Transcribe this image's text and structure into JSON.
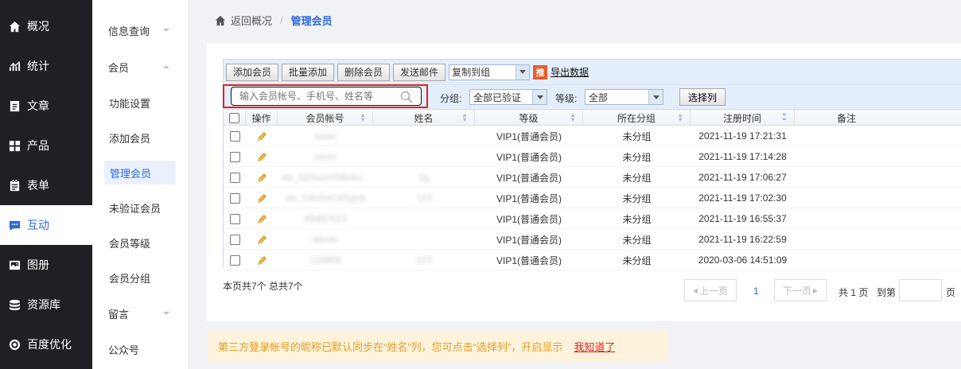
{
  "sidebar": {
    "items": [
      {
        "label": "概况",
        "icon": "home-icon"
      },
      {
        "label": "统计",
        "icon": "stats-icon"
      },
      {
        "label": "文章",
        "icon": "article-icon"
      },
      {
        "label": "产品",
        "icon": "product-icon"
      },
      {
        "label": "表单",
        "icon": "form-icon"
      },
      {
        "label": "互动",
        "icon": "chat-icon",
        "active": true
      },
      {
        "label": "图册",
        "icon": "gallery-icon"
      },
      {
        "label": "资源库",
        "icon": "database-icon"
      },
      {
        "label": "百度优化",
        "icon": "seo-icon"
      }
    ]
  },
  "subnav": {
    "items": [
      {
        "label": "信息查询",
        "type": "group",
        "arrow": "down"
      },
      {
        "label": "会员",
        "type": "group",
        "arrow": "up"
      },
      {
        "label": "功能设置",
        "type": "item"
      },
      {
        "label": "添加会员",
        "type": "item"
      },
      {
        "label": "管理会员",
        "type": "item",
        "active": true
      },
      {
        "label": "未验证会员",
        "type": "item"
      },
      {
        "label": "会员等级",
        "type": "item"
      },
      {
        "label": "会员分组",
        "type": "item"
      },
      {
        "label": "留言",
        "type": "group",
        "arrow": "down"
      },
      {
        "label": "公众号",
        "type": "item"
      }
    ]
  },
  "breadcrumb": {
    "back": "返回概况",
    "separator": "/",
    "current": "管理会员"
  },
  "toolbar": {
    "add_member": "添加会员",
    "bulk_add": "批量添加",
    "delete_member": "删除会员",
    "send_mail": "发送邮件",
    "copy_to_group": "复制到组",
    "tag": "推",
    "export": "导出数据"
  },
  "filter": {
    "search_placeholder": "输入会员帐号、手机号、姓名等",
    "group_label": "分组:",
    "group_value": "全部已验证",
    "level_label": "等级:",
    "level_value": "全部",
    "select_columns": "选择列"
  },
  "table": {
    "headers": [
      "操作",
      "会员帐号",
      "姓名",
      "等级",
      "所在分组",
      "注册时间",
      "备注"
    ],
    "rows": [
      {
        "account": "aaaa",
        "name": "",
        "level": "VIP1(普通会员)",
        "group": "未分组",
        "time": "2021-11-19 17:21:31"
      },
      {
        "account": "cechi",
        "name": "",
        "level": "VIP1(普通会员)",
        "group": "未分组",
        "time": "2021-11-19 17:14:28"
      },
      {
        "account": "wx_0ZSumYMbAu...",
        "name": "hg",
        "level": "VIP1(普通会员)",
        "group": "未分组",
        "time": "2021-11-19 17:06:27"
      },
      {
        "account": "wx_D4cRvCdSgn9",
        "name": "123",
        "level": "VIP1(普通会员)",
        "group": "未分组",
        "time": "2021-11-19 17:02:30"
      },
      {
        "account": "95487613",
        "name": "",
        "level": "VIP1(普通会员)",
        "group": "未分组",
        "time": "2021-11-19 16:55:37"
      },
      {
        "account": "abcde",
        "name": "",
        "level": "VIP1(普通会员)",
        "group": "未分组",
        "time": "2021-11-19 16:22:59"
      },
      {
        "account": "123456",
        "name": "123",
        "level": "VIP1(普通会员)",
        "group": "未分组",
        "time": "2020-03-06 14:51:09"
      }
    ]
  },
  "summary": "本页共7个 总共7个",
  "pager": {
    "prev": "上一页",
    "current_page": "1",
    "next": "下一页",
    "total": "共 1 页",
    "goto": "到第",
    "page_unit": "页"
  },
  "notice": {
    "text": "第三方登录帐号的昵称已默认同步在“姓名”列，您可点击“选择列”，开启显示",
    "link": "我知道了"
  },
  "colors": {
    "sidebar_bg": "#1f2023",
    "accent": "#2d6ad6",
    "highlight": "#e02020",
    "notice_bg": "#fdf3dc",
    "notice_text": "#e69c24"
  }
}
